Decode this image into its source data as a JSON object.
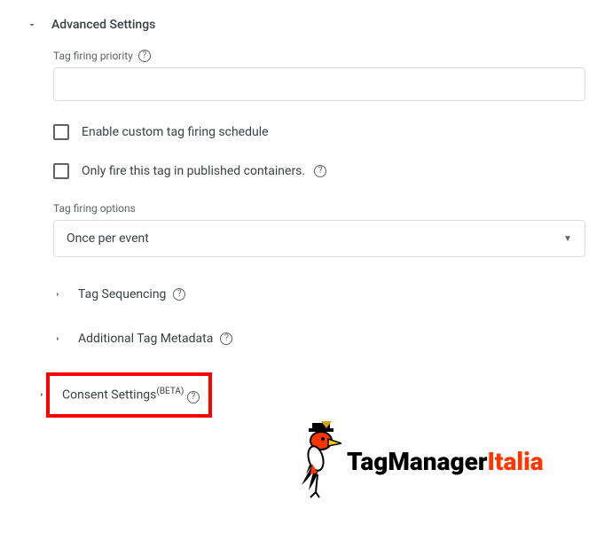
{
  "section_title": "Advanced Settings",
  "priority": {
    "label": "Tag firing priority",
    "value": ""
  },
  "checkbox1": {
    "label": "Enable custom tag firing schedule"
  },
  "checkbox2": {
    "label": "Only fire this tag in published containers."
  },
  "firing_options": {
    "label": "Tag firing options",
    "selected": "Once per event"
  },
  "subsections": {
    "sequencing": "Tag Sequencing",
    "metadata": "Additional Tag Metadata",
    "consent": "Consent Settings",
    "consent_badge": "(BETA)"
  },
  "logo": {
    "part1": "TagManager",
    "part2": "Italia"
  }
}
